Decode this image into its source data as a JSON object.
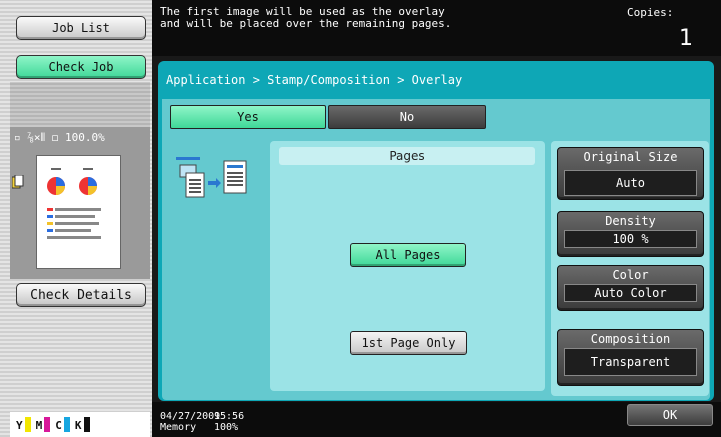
{
  "sidebar": {
    "job_list_label": "Job List",
    "check_job_label": "Check Job",
    "preview": {
      "info": "▫ ⅞×⫴ ◻ 100.0%",
      "zoom": "100.0%"
    },
    "check_details_label": "Check Details",
    "toner": [
      {
        "letter": "Y",
        "color": "#f2e600",
        "level": 0.9
      },
      {
        "letter": "M",
        "color": "#d8189a",
        "level": 0.9
      },
      {
        "letter": "C",
        "color": "#17a6e0",
        "level": 0.9
      },
      {
        "letter": "K",
        "color": "#111111",
        "level": 0.9
      }
    ]
  },
  "message": {
    "text": "The first image will be used as the overlay\nand will be placed over the remaining pages.",
    "copies_label": "Copies:",
    "copies_value": "1"
  },
  "breadcrumb": "Application > Stamp/Composition > Overlay",
  "toggle": {
    "yes_label": "Yes",
    "no_label": "No",
    "selected": "Yes"
  },
  "pages": {
    "title": "Pages",
    "all_pages_label": "All Pages",
    "first_page_only_label": "1st Page Only",
    "selected": "All Pages"
  },
  "settings": {
    "original_size": {
      "label": "Original Size",
      "value": "Auto"
    },
    "density": {
      "label": "Density",
      "value": "100  %"
    },
    "color": {
      "label": "Color",
      "value": "Auto Color"
    },
    "composition": {
      "label": "Composition",
      "value": "Transparent"
    }
  },
  "status": {
    "date": "04/27/2009",
    "time": "15:56",
    "memory_label": "Memory",
    "memory_value": "100%",
    "ok_label": "OK"
  },
  "colors": {
    "accent_green": "#3fd898",
    "panel_teal": "#0ea7b6",
    "panel_light": "#9be3e6"
  }
}
